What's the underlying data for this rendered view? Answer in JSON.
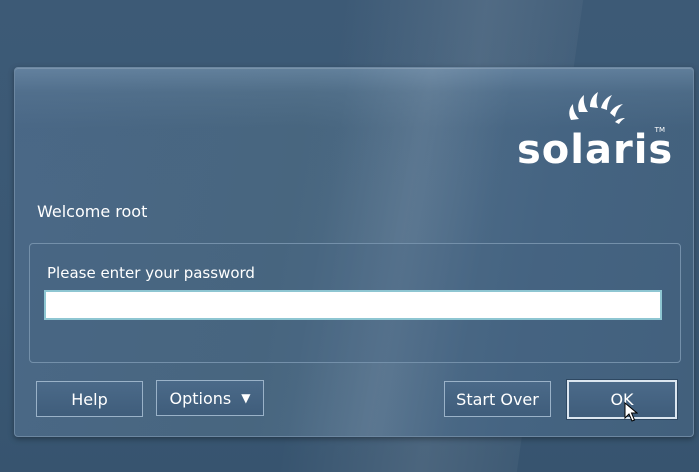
{
  "logo": {
    "wordmark": "solaris",
    "trademark": "TM"
  },
  "welcome_text": "Welcome root",
  "password_prompt": {
    "label": "Please enter your password",
    "value": "",
    "placeholder": ""
  },
  "buttons": {
    "help": "Help",
    "options": "Options",
    "options_arrow": "▼",
    "start_over": "Start Over",
    "ok": "OK"
  },
  "colors": {
    "background": "#3d5a76",
    "dialog": "#48667f",
    "input_border": "#8ec6d2",
    "text": "#ffffff"
  }
}
